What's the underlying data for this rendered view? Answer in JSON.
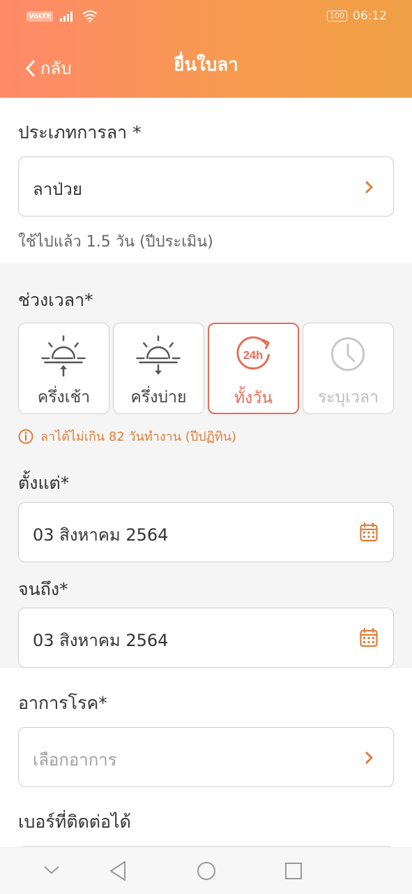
{
  "status": {
    "carrier_tag": "VoLTE",
    "battery": "100",
    "time": "06:12"
  },
  "header": {
    "back_label": "กลับ",
    "title": "ยื่นใบลา"
  },
  "leave_type": {
    "label": "ประเภทการลา *",
    "value": "ลาป่วย",
    "usage_note": "ใช้ไปแล้ว 1.5 วัน (ปีประเมิน)"
  },
  "period": {
    "label": "ช่วงเวลา*",
    "options": [
      {
        "label": "ครึ่งเช้า",
        "icon": "sunrise-icon",
        "state": "normal"
      },
      {
        "label": "ครึ่งบ่าย",
        "icon": "sunset-icon",
        "state": "normal"
      },
      {
        "label": "ทั้งวัน",
        "icon": "24h-icon",
        "state": "selected"
      },
      {
        "label": "ระบุเวลา",
        "icon": "clock-icon",
        "state": "disabled"
      }
    ],
    "warning": "ลาได้ไม่เกิน 82 วันทำงาน (ปีปฏิทิน)"
  },
  "date_from": {
    "label": "ตั้งแต่*",
    "value": "03 สิงหาคม 2564"
  },
  "date_to": {
    "label": "จนถึง*",
    "value": "03 สิงหาคม 2564"
  },
  "symptom": {
    "label": "อาการโรค*",
    "placeholder": "เลือกอาการ"
  },
  "contact": {
    "label": "เบอร์ที่ติดต่อได้"
  },
  "colors": {
    "accent": "#e96b56",
    "orange": "#e07d3a",
    "header_from": "#ff8a6a",
    "header_to": "#f0a046"
  }
}
